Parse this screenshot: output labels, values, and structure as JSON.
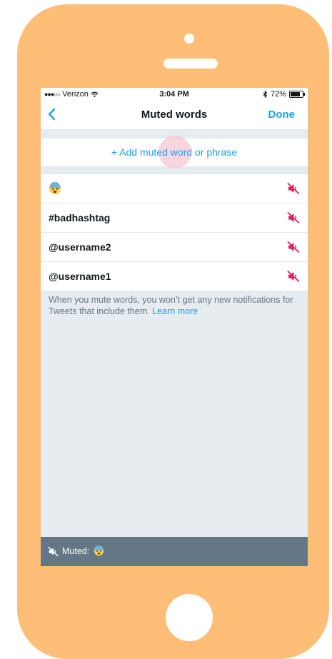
{
  "status_bar": {
    "carrier": "Verizon",
    "time": "3:04 PM",
    "battery": "72%",
    "battery_level": 0.72
  },
  "nav": {
    "title": "Muted words",
    "done_label": "Done",
    "back_icon": "chevron-left-icon"
  },
  "add": {
    "label": "+ Add muted word or phrase"
  },
  "muted_items": [
    {
      "label": "",
      "kind": "emoji",
      "icon": "anxious-face-emoji"
    },
    {
      "label": "#badhashtag",
      "kind": "text"
    },
    {
      "label": "@username2",
      "kind": "text"
    },
    {
      "label": "@username1",
      "kind": "text"
    }
  ],
  "info": {
    "text": "When you mute words, you won’t get any new notifications for Tweets that include them. ",
    "link": "Learn more"
  },
  "toast": {
    "label": "Muted:"
  },
  "colors": {
    "accent": "#1DA1F2",
    "mute": "#E0245E",
    "phone": "#FFBE78",
    "toast_bg": "#657786",
    "screen_bg": "#E6ECF0"
  }
}
